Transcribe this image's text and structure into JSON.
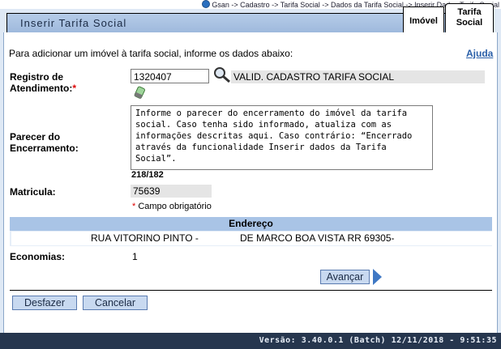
{
  "breadcrumb": "Gsan -> Cadastro -> Tarifa Social -> Dados da Tarifa Social -> Inserir Dados Tarifa Social",
  "page_title": "Inserir Tarifa Social",
  "tabs": [
    {
      "label": "Imóvel"
    },
    {
      "label_line1": "Tarifa",
      "label_line2": "Social"
    }
  ],
  "intro_text": "Para adicionar um imóvel à tarifa social, informe os dados abaixo:",
  "help_label": "Ajuda",
  "registro": {
    "label_line1": "Registro de",
    "label_line2": "Atendimento:",
    "required_mark": "*",
    "value": "1320407",
    "description": "VALID. CADASTRO TARIFA SOCIAL"
  },
  "parecer": {
    "label_line1": "Parecer do",
    "label_line2": "Encerramento:",
    "value": "Informe o parecer do encerramento do imóvel da tarifa social. Caso tenha sido informado, atualiza com as informações descritas aqui. Caso contrário: “Encerrado através da funcionalidade Inserir dados da Tarifa Social”.",
    "counter": "218/182"
  },
  "matricula": {
    "label": "Matricula:",
    "value": "75639"
  },
  "required_note": {
    "mark": "*",
    "text": " Campo obrigatório"
  },
  "endereco": {
    "header": "Endereço",
    "part1": "RUA VITORINO PINTO -",
    "part2": "DE MARCO BOA VISTA RR 69305-"
  },
  "economias": {
    "label": "Economias:",
    "value": "1"
  },
  "buttons": {
    "avancar": "Avançar",
    "desfazer": "Desfazer",
    "cancelar": "Cancelar"
  },
  "footer": "Versão: 3.40.0.1 (Batch) 12/11/2018 - 9:51:35"
}
